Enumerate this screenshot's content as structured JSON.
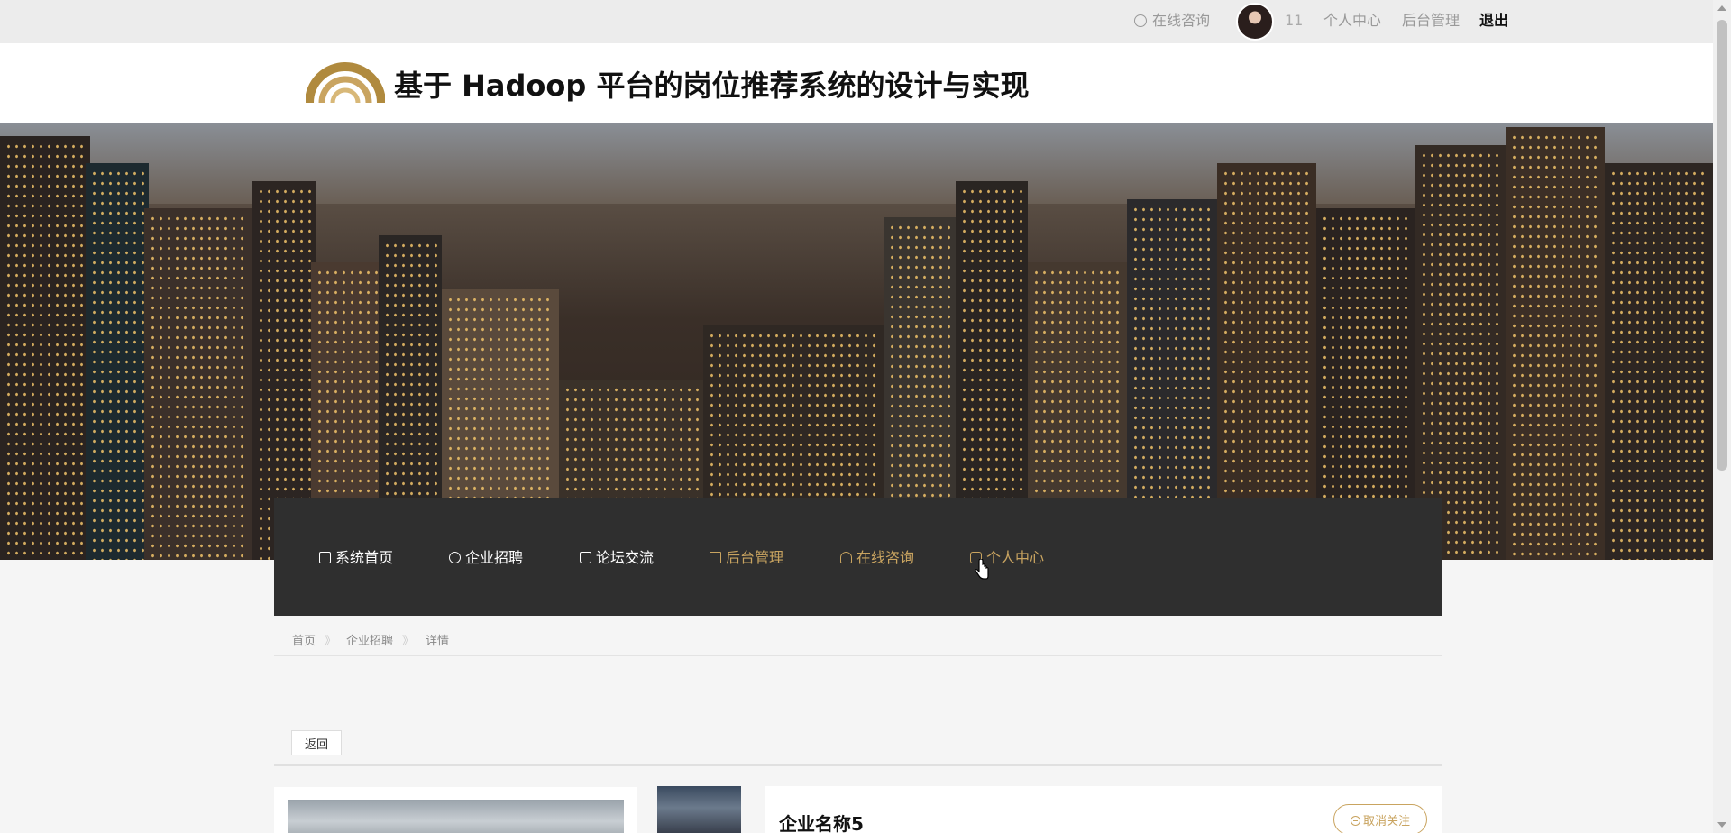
{
  "topbar": {
    "consult_label": "在线咨询",
    "username": "11",
    "center_label": "个人中心",
    "admin_label": "后台管理",
    "logout_label": "退出"
  },
  "header": {
    "title": "基于 Hadoop 平台的岗位推荐系统的设计与实现"
  },
  "nav": {
    "items": [
      {
        "label": "系统首页",
        "icon": "home-icon"
      },
      {
        "label": "企业招聘",
        "icon": "star-icon"
      },
      {
        "label": "论坛交流",
        "icon": "bag-icon"
      },
      {
        "label": "后台管理",
        "icon": "list-icon"
      },
      {
        "label": "在线咨询",
        "icon": "person-icon"
      },
      {
        "label": "个人中心",
        "icon": "house-icon"
      }
    ]
  },
  "breadcrumb": {
    "home": "首页",
    "sep": "》",
    "section": "企业招聘",
    "current": "详情"
  },
  "toolbar": {
    "back_label": "返回"
  },
  "detail": {
    "company_name": "企业名称5",
    "unfollow_label": "取消关注"
  },
  "colors": {
    "accent": "#c9a460",
    "nav_bg": "#2f2f2f"
  }
}
